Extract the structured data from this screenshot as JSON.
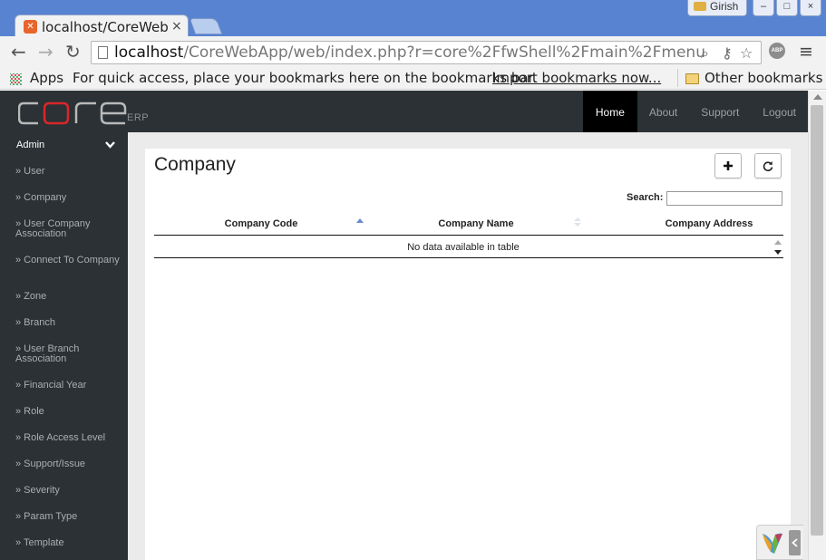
{
  "browser": {
    "tab_title": "localhost/CoreWebA",
    "tab_close": "×",
    "profile_name": "Girish",
    "url_host": "localhost",
    "url_rest": "/CoreWebApp/web/index.php?r=core%2FfwShell%2Fmain%2Fmenu",
    "abp_label": "ABP",
    "bookmarks": {
      "apps_label": "Apps",
      "hint": "For quick access, place your bookmarks here on the bookmarks bar.",
      "import_link": "Import bookmarks now...",
      "other": "Other bookmarks"
    }
  },
  "header": {
    "logo_sub": "ERP",
    "nav": [
      {
        "label": "Home",
        "active": true
      },
      {
        "label": "About"
      },
      {
        "label": "Support"
      },
      {
        "label": "Logout"
      }
    ]
  },
  "sidebar": {
    "section": "Admin",
    "items": [
      "» User",
      "» Company",
      "» User Company Association",
      "» Connect To Company",
      "» Zone",
      "» Branch",
      "» User Branch Association",
      "» Financial Year",
      "» Role",
      "» Role Access Level",
      "» Support/Issue",
      "» Severity",
      "» Param Type",
      "» Template"
    ]
  },
  "main": {
    "title": "Company",
    "search_label": "Search:",
    "search_value": "",
    "table": {
      "columns": [
        "Company Code",
        "Company Name",
        "Company Address"
      ],
      "empty_message": "No data available in table"
    }
  },
  "colors": {
    "header_bg": "#2b3134",
    "nav_active_bg": "#000000",
    "content_bg": "#ebebeb",
    "browser_frame": "#5783d1"
  }
}
